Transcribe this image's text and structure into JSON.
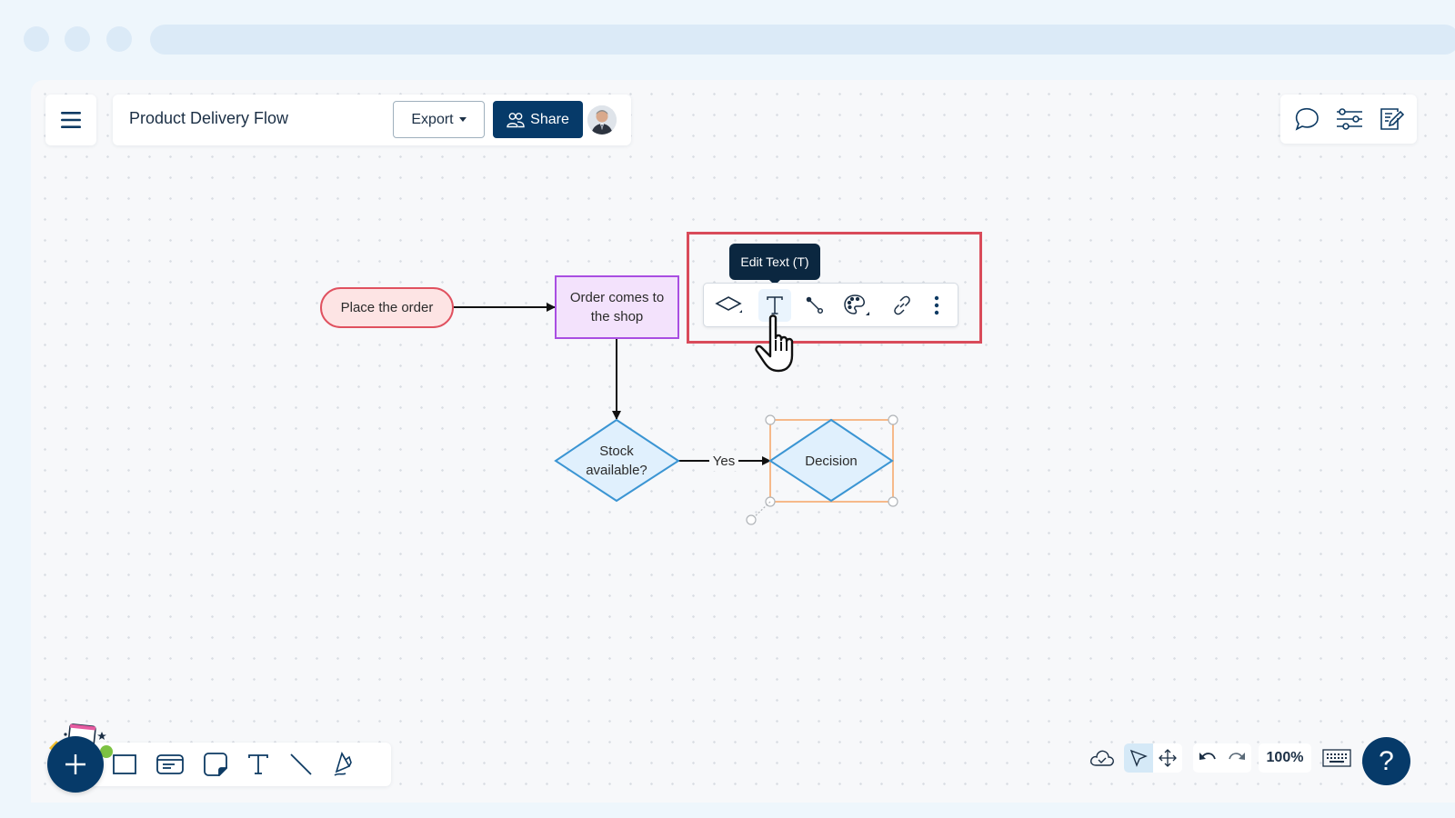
{
  "header": {
    "title": "Product Delivery Flow",
    "export_label": "Export",
    "share_label": "Share"
  },
  "icons": {
    "menu": "hamburger-icon",
    "share": "people-icon",
    "comments": "speech-bubble-icon",
    "settings": "sliders-icon",
    "notes": "edit-note-icon"
  },
  "diagram": {
    "nodes": [
      {
        "id": "n1",
        "type": "terminator",
        "label": "Place the order",
        "fill": "#fde4e4",
        "stroke": "#e0515f"
      },
      {
        "id": "n2",
        "type": "process",
        "label_line1": "Order comes to",
        "label_line2": "the shop",
        "fill": "#f3e2fc",
        "stroke": "#a94ee2"
      },
      {
        "id": "n3",
        "type": "decision",
        "label_line1": "Stock",
        "label_line2": "available?",
        "fill": "#e0f0fd",
        "stroke": "#3b95d3"
      },
      {
        "id": "n4",
        "type": "decision",
        "label": "Decision",
        "fill": "#e0f0fd",
        "stroke": "#3b95d3",
        "selected": true
      }
    ],
    "edges": [
      {
        "from": "n1",
        "to": "n2",
        "label": ""
      },
      {
        "from": "n2",
        "to": "n3",
        "label": ""
      },
      {
        "from": "n3",
        "to": "n4",
        "label": "Yes"
      }
    ],
    "selection_color": "#f6b98a"
  },
  "context_toolbar": {
    "tooltip": "Edit Text (T)",
    "items": [
      {
        "name": "shape-icon",
        "label": "Change shape"
      },
      {
        "name": "text-icon",
        "label": "Edit Text (T)",
        "active": true
      },
      {
        "name": "connector-icon",
        "label": "Connector"
      },
      {
        "name": "palette-icon",
        "label": "Colors"
      },
      {
        "name": "link-icon",
        "label": "Link"
      },
      {
        "name": "more-vertical-icon",
        "label": "More"
      }
    ],
    "highlight_color": "#d94b5a"
  },
  "bottom_toolbar": {
    "tools": [
      "rectangle-icon",
      "card-icon",
      "sticky-note-icon",
      "text-icon",
      "line-icon",
      "pen-icon"
    ]
  },
  "bottom_right": {
    "zoom": "100%",
    "help": "?"
  },
  "colors": {
    "brand": "#063a69",
    "text": "#1b2f45"
  }
}
